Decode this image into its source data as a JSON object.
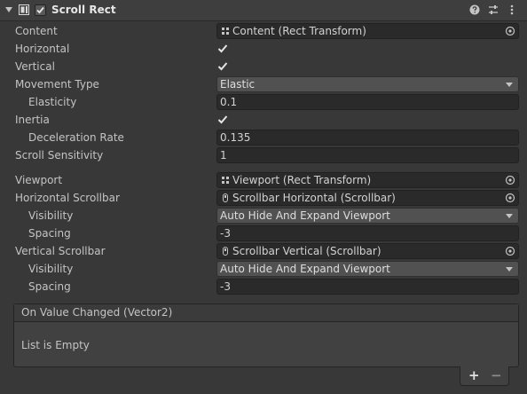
{
  "component": {
    "title": "Scroll Rect",
    "icons": {
      "component": "scroll-rect-component-icon",
      "help": "help-icon",
      "presets": "presets-icon",
      "menu": "kebab-menu-icon"
    }
  },
  "fields": {
    "content": {
      "label": "Content",
      "value": "Content (Rect Transform)"
    },
    "horizontal": {
      "label": "Horizontal",
      "checked": true
    },
    "vertical": {
      "label": "Vertical",
      "checked": true
    },
    "movement_type": {
      "label": "Movement Type",
      "value": "Elastic"
    },
    "elasticity": {
      "label": "Elasticity",
      "value": "0.1"
    },
    "inertia": {
      "label": "Inertia",
      "checked": true
    },
    "deceleration_rate": {
      "label": "Deceleration Rate",
      "value": "0.135"
    },
    "scroll_sensitivity": {
      "label": "Scroll Sensitivity",
      "value": "1"
    },
    "viewport": {
      "label": "Viewport",
      "value": "Viewport (Rect Transform)"
    },
    "horizontal_scrollbar": {
      "label": "Horizontal Scrollbar",
      "value": "Scrollbar Horizontal (Scrollbar)"
    },
    "h_visibility": {
      "label": "Visibility",
      "value": "Auto Hide And Expand Viewport"
    },
    "h_spacing": {
      "label": "Spacing",
      "value": "-3"
    },
    "vertical_scrollbar": {
      "label": "Vertical Scrollbar",
      "value": "Scrollbar Vertical (Scrollbar)"
    },
    "v_visibility": {
      "label": "Visibility",
      "value": "Auto Hide And Expand Viewport"
    },
    "v_spacing": {
      "label": "Spacing",
      "value": "-3"
    }
  },
  "event": {
    "title": "On Value Changed (Vector2)",
    "empty_text": "List is Empty",
    "add": "+",
    "remove": "−"
  },
  "colors": {
    "background": "#383838",
    "field": "#2a2a2a",
    "dropdown": "#515151",
    "text": "#c4c4c4"
  }
}
